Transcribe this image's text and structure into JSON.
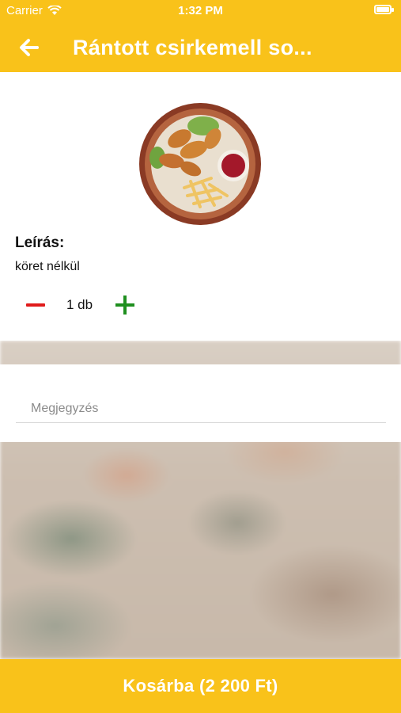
{
  "status_bar": {
    "carrier": "Carrier",
    "time": "1:32 PM"
  },
  "header": {
    "title": "Rántott csirkemell so...",
    "back_icon": "arrow-left-icon"
  },
  "product": {
    "image_alt": "fried chicken with fries and sauce",
    "description_title": "Leírás:",
    "description": "köret nélkül",
    "quantity_label": "1 db"
  },
  "note": {
    "placeholder": "Megjegyzés",
    "value": ""
  },
  "footer": {
    "cart_button_label": "Kosárba (2 200 Ft)"
  },
  "colors": {
    "accent": "#f9c21a",
    "minus": "#e01b1b",
    "plus": "#1f8f1f"
  }
}
